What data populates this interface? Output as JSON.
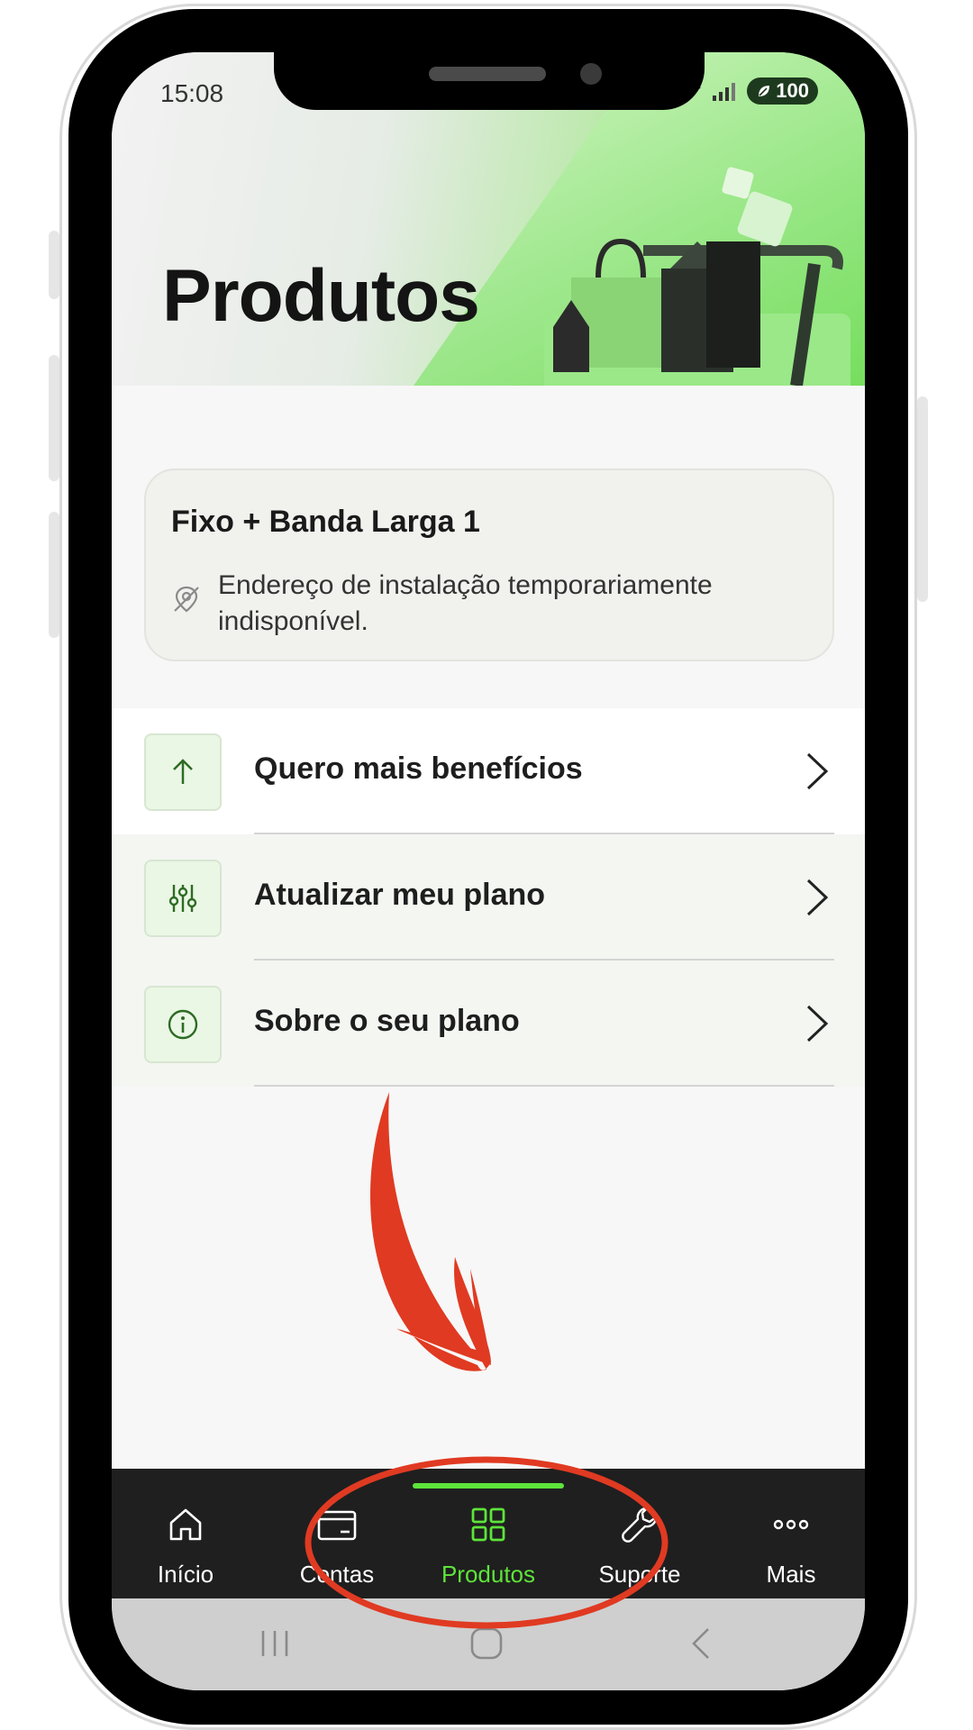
{
  "status_bar": {
    "time": "15:08",
    "battery": "100",
    "icons": [
      "wifi-icon",
      "signal-icon",
      "battery-leaf-icon"
    ]
  },
  "header": {
    "title": "Produtos",
    "illustration": "shopping-bags-cart-illustration"
  },
  "product_card": {
    "title": "Fixo + Banda Larga 1",
    "message": "Endereço de instalação temporariamente indisponível.",
    "icon": "location-off-icon"
  },
  "menu": {
    "items": [
      {
        "label": "Quero mais benefícios",
        "icon": "arrow-up-icon"
      },
      {
        "label": "Atualizar meu plano",
        "icon": "sliders-icon"
      },
      {
        "label": "Sobre o seu plano",
        "icon": "info-icon"
      }
    ]
  },
  "bottom_nav": {
    "items": [
      {
        "label": "Início",
        "icon": "home-icon",
        "active": false
      },
      {
        "label": "Contas",
        "icon": "card-icon",
        "active": false
      },
      {
        "label": "Produtos",
        "icon": "grid-icon",
        "active": true
      },
      {
        "label": "Suporte",
        "icon": "wrench-icon",
        "active": false
      },
      {
        "label": "Mais",
        "icon": "more-dots-icon",
        "active": false
      }
    ]
  },
  "colors": {
    "accent": "#5de43a",
    "nav_bg": "#1f1f1f",
    "annotation": "#e03a22"
  }
}
